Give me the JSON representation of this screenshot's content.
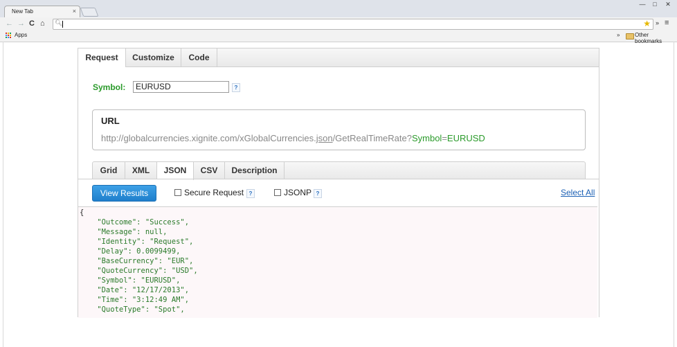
{
  "browser": {
    "tab_title": "New Tab",
    "tab_close": "×",
    "window": {
      "minimize": "—",
      "maximize": "□",
      "close": "✕"
    },
    "nav": {
      "back": "←",
      "forward": "→",
      "reload": "C",
      "home": "⌂"
    },
    "omnibox_value": "",
    "more_extensions": "»",
    "menu_glyph": "≡",
    "bookmarks": {
      "apps_label": "Apps",
      "more": "»",
      "other_label": "Other bookmarks"
    }
  },
  "widget": {
    "top_tabs": [
      "Request",
      "Customize",
      "Code"
    ],
    "active_top_tab": "Request",
    "symbol": {
      "label": "Symbol:",
      "value": "EURUSD",
      "help": "?"
    },
    "url_box": {
      "title": "URL",
      "base": "http://globalcurrencies.xignite.com/xGlobalCurrencies.",
      "format": "json",
      "path": "/GetRealTimeRate?",
      "param_key": "Symbol",
      "param_eq": "=",
      "param_value": "EURUSD"
    },
    "format_tabs": [
      "Grid",
      "XML",
      "JSON",
      "CSV",
      "Description"
    ],
    "active_format_tab": "JSON",
    "view_button": "View Results",
    "secure_request": {
      "label": "Secure Request",
      "checked": false,
      "help": "?"
    },
    "jsonp": {
      "label": "JSONP",
      "checked": false,
      "help": "?"
    },
    "select_all": "Select All",
    "response_lines": [
      "{",
      "    \"Outcome\": \"Success\",",
      "    \"Message\": null,",
      "    \"Identity\": \"Request\",",
      "    \"Delay\": 0.0099499,",
      "    \"BaseCurrency\": \"EUR\",",
      "    \"QuoteCurrency\": \"USD\",",
      "    \"Symbol\": \"EURUSD\",",
      "    \"Date\": \"12/17/2013\",",
      "    \"Time\": \"3:12:49 AM\",",
      "    \"QuoteType\": \"Spot\","
    ]
  },
  "colors": {
    "label_green": "#2a9a2a",
    "button_blue": "#2188d8",
    "link_blue": "#1a5fb4",
    "code_bg": "#fdf7f9"
  }
}
